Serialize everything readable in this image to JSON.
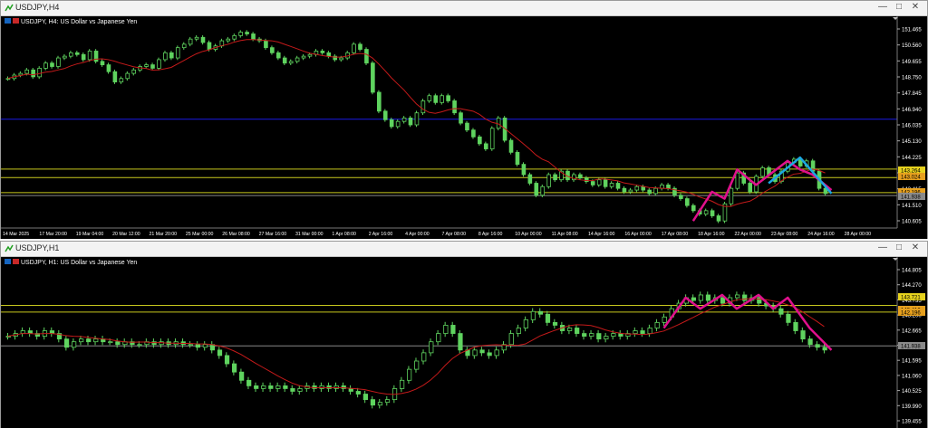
{
  "charts": [
    {
      "window_title": "USDJPY,H4",
      "header": "USDJPY, H4:  US Dollar vs Japanese Yen",
      "y_ticks": [
        "151.465",
        "150.560",
        "149.655",
        "148.750",
        "147.845",
        "146.940",
        "146.035",
        "145.130",
        "144.225",
        "143.320",
        "142.415",
        "141.510",
        "140.605"
      ],
      "x_ticks": [
        "14 Mar 2025",
        "17 Mar 20:00",
        "19 Mar 04:00",
        "20 Mar 12:00",
        "21 Mar 20:00",
        "25 Mar 00:00",
        "26 Mar 08:00",
        "27 Mar 16:00",
        "31 Mar 00:00",
        "1 Apr 08:00",
        "2 Apr 16:00",
        "4 Apr 00:00",
        "7 Apr 08:00",
        "8 Apr 16:00",
        "10 Apr 00:00",
        "11 Apr 08:00",
        "14 Apr 16:00",
        "16 Apr 00:00",
        "17 Apr 08:00",
        "18 Apr 16:00",
        "22 Apr 00:00",
        "23 Apr 08:00",
        "24 Apr 16:00",
        "28 Apr 00:00"
      ],
      "price_tags": [
        "143.264",
        "143.024",
        "142.196",
        "141.938"
      ],
      "ymin": 140.1,
      "ymax": 151.7,
      "hlines": [
        {
          "price": 146.23,
          "color": "#1a1ae6"
        },
        {
          "price": 143.32,
          "color": "#c8c81e"
        },
        {
          "price": 142.83,
          "color": "#c8c81e"
        },
        {
          "price": 141.95,
          "color": "#c8c81e"
        },
        {
          "price": 141.78,
          "color": "#888888"
        }
      ],
      "closes": [
        148.6,
        148.8,
        148.9,
        149.1,
        148.7,
        149.2,
        149.5,
        149.3,
        149.8,
        149.9,
        150.1,
        150.0,
        149.7,
        150.2,
        149.6,
        149.4,
        149.0,
        148.4,
        148.6,
        148.9,
        149.1,
        149.3,
        149.4,
        149.2,
        149.7,
        150.1,
        149.8,
        150.4,
        150.6,
        150.9,
        151.0,
        150.7,
        150.3,
        150.5,
        150.8,
        150.9,
        151.1,
        151.3,
        151.2,
        150.9,
        150.8,
        150.4,
        150.1,
        149.8,
        149.5,
        149.6,
        149.8,
        149.9,
        150.0,
        150.2,
        150.1,
        149.9,
        149.7,
        149.8,
        150.1,
        150.6,
        150.3,
        149.5,
        147.8,
        146.7,
        146.2,
        145.8,
        146.1,
        146.3,
        145.9,
        146.6,
        147.3,
        147.6,
        147.2,
        147.6,
        147.3,
        146.6,
        146.0,
        145.6,
        145.2,
        144.8,
        144.5,
        145.7,
        146.3,
        145.0,
        144.3,
        143.6,
        143.0,
        142.5,
        141.8,
        142.3,
        143.0,
        142.7,
        143.2,
        142.7,
        143.0,
        142.8,
        142.6,
        142.4,
        142.7,
        142.3,
        142.5,
        142.2,
        142.0,
        142.1,
        142.3,
        142.1,
        141.9,
        142.2,
        142.4,
        142.2,
        141.8,
        141.6,
        141.2,
        140.9,
        140.7,
        140.9,
        140.6,
        140.3,
        141.3,
        142.2,
        143.1,
        142.5,
        142.0,
        142.9,
        143.4,
        143.0,
        142.6,
        143.2,
        143.7,
        143.9,
        143.5,
        143.8,
        143.2,
        142.2,
        141.9
      ],
      "ma_color": "#c41a1a",
      "patterns": [
        {
          "color": "#e0108c",
          "points": [
            [
              109,
              140.3
            ],
            [
              112,
              142.0
            ],
            [
              114,
              141.6
            ],
            [
              116,
              143.3
            ],
            [
              119,
              142.4
            ],
            [
              124,
              143.8
            ],
            [
              126,
              143.3
            ],
            [
              128,
              143.0
            ],
            [
              131,
              142.1
            ]
          ]
        },
        {
          "color": "#1ca8e0",
          "points": [
            [
              121,
              142.5
            ],
            [
              126,
              144.0
            ],
            [
              131,
              141.9
            ]
          ]
        }
      ]
    },
    {
      "window_title": "USDJPY,H1",
      "header": "USDJPY, H1:  US Dollar vs Japanese Yen",
      "y_ticks": [
        "144.805",
        "144.270",
        "143.735",
        "143.200",
        "142.665",
        "142.130",
        "141.595",
        "141.060",
        "140.525",
        "139.990",
        "139.455"
      ],
      "x_ticks": [],
      "price_tags": [
        "143.721",
        "143.410",
        "142.196",
        "141.938"
      ],
      "ymin": 139.3,
      "ymax": 145.05,
      "hlines": [
        {
          "price": 143.62,
          "color": "#c8c81e"
        },
        {
          "price": 143.38,
          "color": "#c8c81e"
        },
        {
          "price": 142.15,
          "color": "#888888"
        }
      ],
      "closes": [
        142.5,
        142.6,
        142.7,
        142.6,
        142.5,
        142.7,
        142.6,
        142.4,
        142.1,
        142.3,
        142.4,
        142.3,
        142.4,
        142.3,
        142.3,
        142.2,
        142.3,
        142.2,
        142.2,
        142.3,
        142.2,
        142.3,
        142.2,
        142.3,
        142.2,
        142.2,
        142.1,
        142.2,
        142.0,
        141.8,
        141.5,
        141.2,
        140.9,
        140.7,
        140.6,
        140.7,
        140.6,
        140.7,
        140.6,
        140.5,
        140.6,
        140.7,
        140.6,
        140.7,
        140.6,
        140.7,
        140.6,
        140.5,
        140.4,
        140.2,
        140.0,
        140.1,
        140.2,
        140.6,
        140.9,
        141.3,
        141.6,
        141.9,
        142.3,
        142.6,
        142.9,
        142.6,
        142.0,
        141.8,
        142.0,
        141.9,
        141.8,
        142.0,
        142.2,
        142.6,
        142.8,
        143.1,
        143.4,
        143.3,
        143.0,
        142.9,
        142.7,
        142.8,
        142.6,
        142.5,
        142.6,
        142.4,
        142.5,
        142.6,
        142.5,
        142.6,
        142.7,
        142.6,
        142.8,
        143.0,
        143.2,
        143.5,
        143.7,
        143.9,
        143.8,
        144.0,
        143.8,
        143.9,
        143.7,
        143.9,
        144.0,
        143.8,
        143.9,
        143.7,
        143.6,
        143.5,
        143.3,
        143.0,
        142.7,
        142.4,
        142.2,
        142.1,
        142.0
      ],
      "ma_color": "#c41a1a",
      "patterns": [
        {
          "color": "#e0108c",
          "points": [
            [
              90,
              142.8
            ],
            [
              93,
              143.9
            ],
            [
              95,
              143.5
            ],
            [
              98,
              144.0
            ],
            [
              100,
              143.5
            ],
            [
              103,
              144.0
            ],
            [
              105,
              143.5
            ],
            [
              107,
              143.9
            ],
            [
              110,
              142.8
            ],
            [
              113,
              142.0
            ]
          ]
        }
      ]
    }
  ]
}
